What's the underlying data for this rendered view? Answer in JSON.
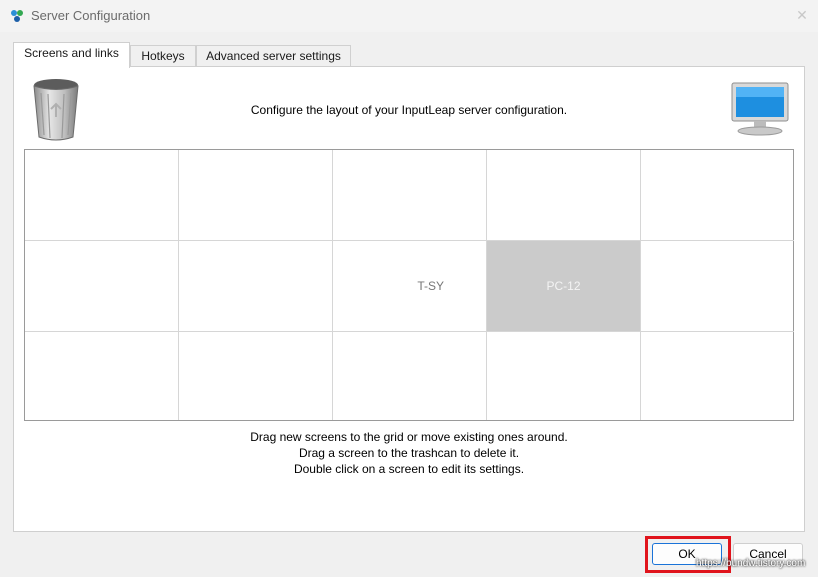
{
  "window": {
    "title": "Server Configuration",
    "close_glyph": "✕"
  },
  "tabs": [
    {
      "label": "Screens and links",
      "active": true
    },
    {
      "label": "Hotkeys",
      "active": false
    },
    {
      "label": "Advanced server settings",
      "active": false
    }
  ],
  "screens": {
    "caption": "Configure the layout of your InputLeap server configuration.",
    "grid": {
      "rows": 3,
      "cols": 5,
      "cells": [
        [
          "",
          "",
          "",
          "",
          ""
        ],
        [
          "",
          "",
          "T-SY",
          "PC-12",
          ""
        ],
        [
          "",
          "",
          "",
          "",
          ""
        ]
      ],
      "selected_cell": {
        "row": 1,
        "col": 3
      }
    },
    "help_lines": [
      "Drag new screens to the grid or move existing ones around.",
      "Drag a screen to the trashcan to delete it.",
      "Double click on a screen to edit its settings."
    ]
  },
  "buttons": {
    "ok": "OK",
    "cancel": "Cancel"
  },
  "watermark": "https://bundw.tistory.com",
  "colors": {
    "highlight": "#e0141c",
    "screen_fill": "#cbcbcb",
    "ok_border": "#1a73d8"
  },
  "icons": {
    "trash": "trashcan-icon",
    "monitor": "monitor-icon",
    "app": "inputleap-app-icon"
  }
}
